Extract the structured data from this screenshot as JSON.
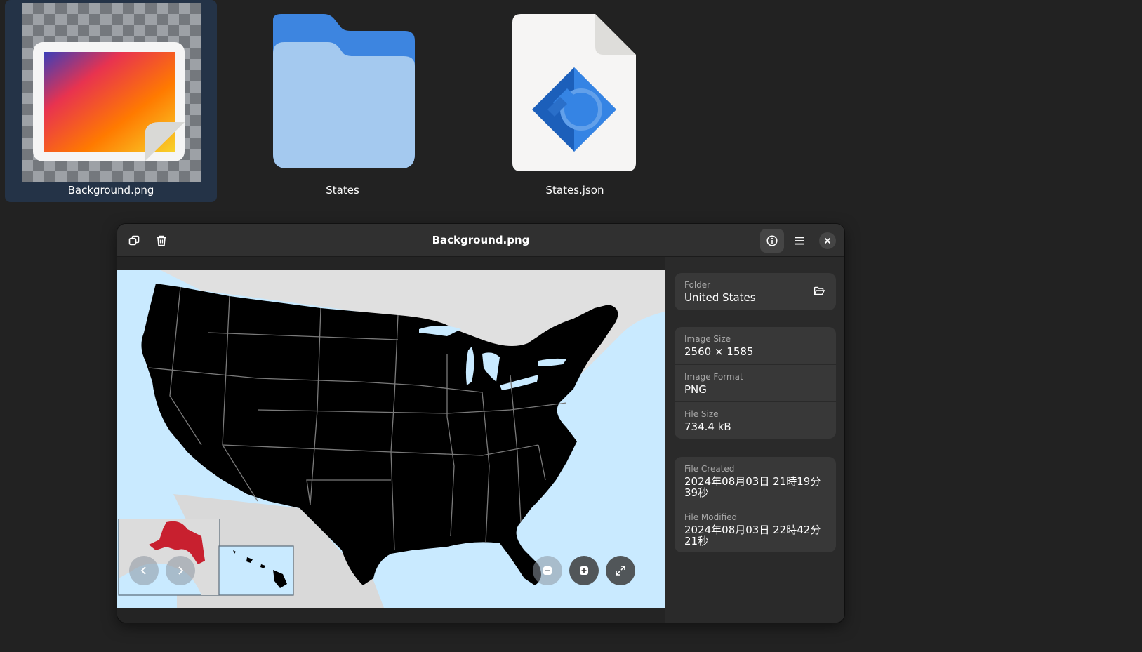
{
  "desktop": {
    "icons": [
      {
        "label": "Background.png"
      },
      {
        "label": "States"
      },
      {
        "label": "States.json"
      }
    ]
  },
  "window": {
    "title": "Background.png",
    "toolbar": {
      "copy_icon": "copy-icon",
      "delete_icon": "trash-icon",
      "info_icon": "info-icon",
      "menu_icon": "hamburger-menu-icon",
      "close_icon": "close-icon"
    }
  },
  "properties": {
    "folder": {
      "label": "Folder",
      "value": "United States"
    },
    "image_size": {
      "label": "Image Size",
      "value": "2560 × 1585"
    },
    "image_format": {
      "label": "Image Format",
      "value": "PNG"
    },
    "file_size": {
      "label": "File Size",
      "value": "734.4 kB"
    },
    "file_created": {
      "label": "File Created",
      "value": "2024年08月03日 21時19分39秒"
    },
    "file_modified": {
      "label": "File Modified",
      "value": "2024年08月03日 22時42分21秒"
    }
  },
  "colors": {
    "accent": "#3584e4",
    "alaska": "#c8202f",
    "water": "#c9eaff",
    "land": "#000000"
  }
}
